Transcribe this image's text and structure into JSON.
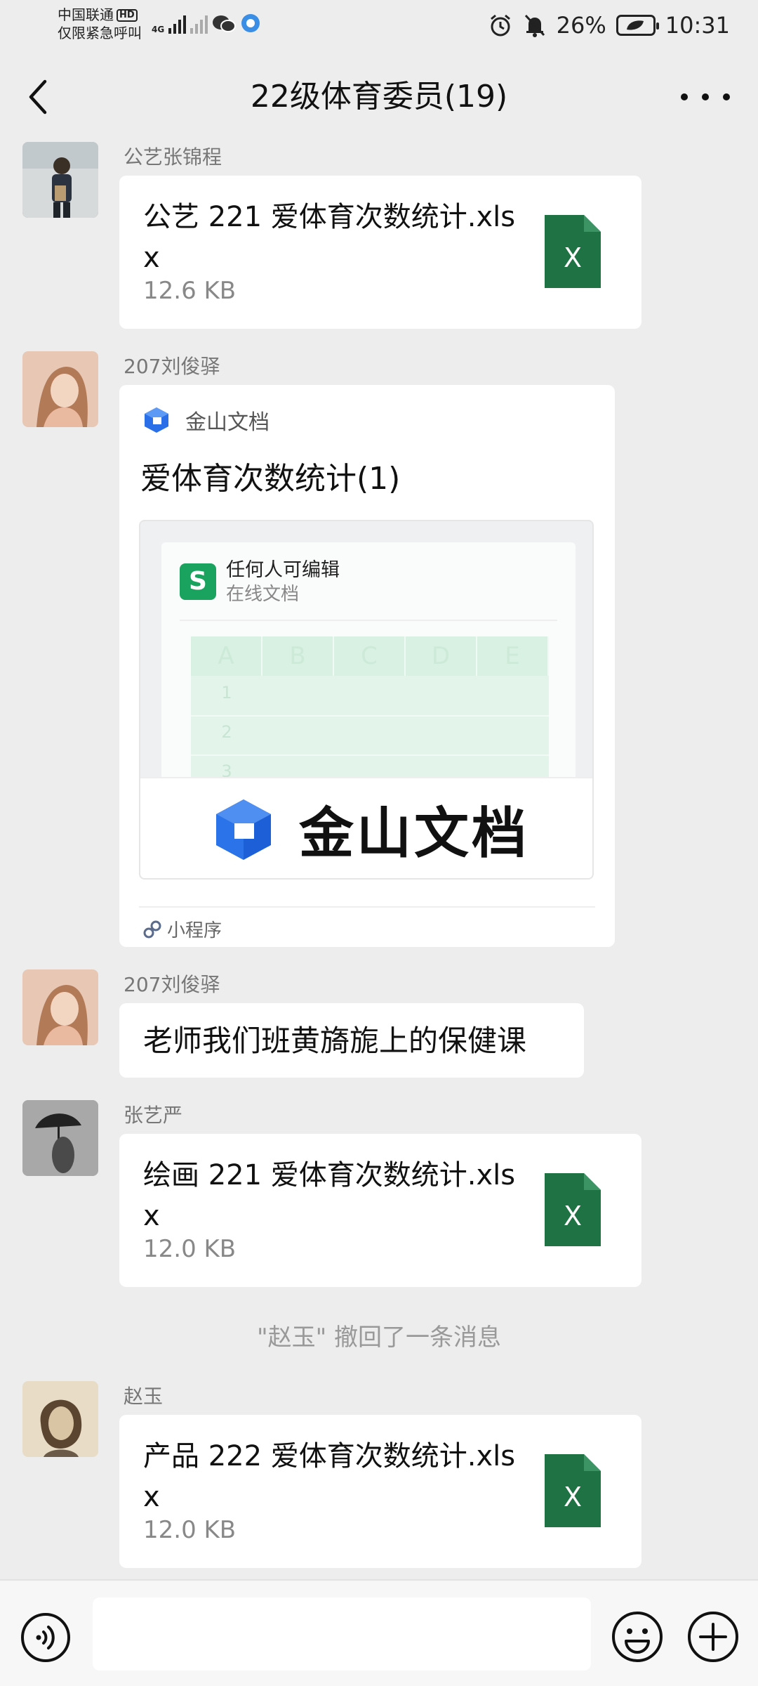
{
  "status_bar": {
    "carrier": "中国联通",
    "carrier_badge": "HD",
    "emergency": "仅限紧急呼叫",
    "network": "4G",
    "battery": "26%",
    "time": "10:31"
  },
  "nav": {
    "title": "22级体育委员(19)"
  },
  "messages": [
    {
      "sender": "公艺张锦程",
      "file_name": "公艺 221 爱体育次数统计.xlsx",
      "file_size": "12.6 KB",
      "file_icon": "X"
    },
    {
      "sender": "207刘俊驿",
      "app_name": "金山文档",
      "card_title": "爱体育次数统计(1)",
      "preview_icon": "S",
      "preview_permission": "任何人可编辑",
      "preview_doc_type": "在线文档",
      "columns": [
        "A",
        "B",
        "C",
        "D",
        "E"
      ],
      "rows": [
        "1",
        "2",
        "3"
      ],
      "brand": "金山文档",
      "footer": "小程序"
    },
    {
      "sender": "207刘俊驿",
      "text": "老师我们班黄旖旎上的保健课"
    },
    {
      "sender": "张艺严",
      "file_name": "绘画 221 爱体育次数统计.xlsx",
      "file_size": "12.0 KB",
      "file_icon": "X"
    },
    {
      "sender": "赵玉",
      "file_name": "产品 222 爱体育次数统计.xlsx",
      "file_size": "12.0 KB",
      "file_icon": "X"
    }
  ],
  "system_message": "\"赵玉\" 撤回了一条消息",
  "input_bar": {
    "placeholder": ""
  },
  "colors": {
    "background": "#ededed",
    "bubble": "#ffffff",
    "excel_green": "#1f7244",
    "sheet_green": "#1aa35f",
    "kdocs_blue": "#2a6ee8"
  },
  "icons": [
    "back-arrow-icon",
    "more-dots-icon",
    "excel-file-icon",
    "kdocs-logo-icon",
    "link-icon",
    "voice-icon",
    "emoji-icon",
    "plus-icon"
  ]
}
